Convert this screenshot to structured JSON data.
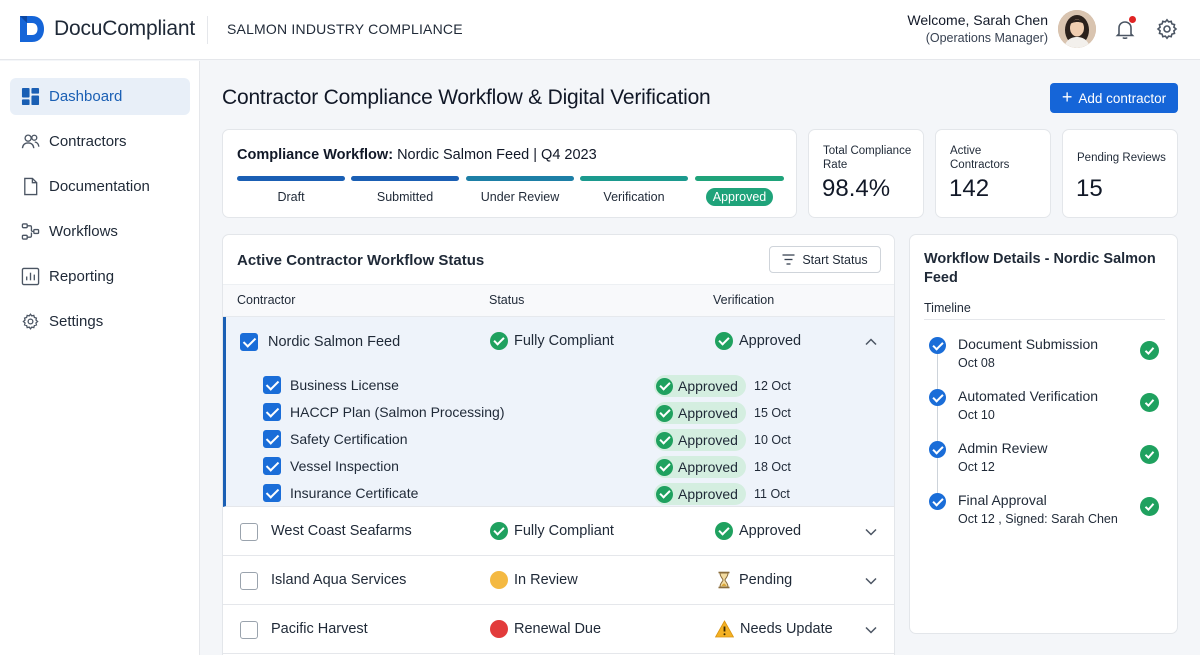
{
  "app": {
    "name": "DocuCompliant",
    "subtitle": "SALMON INDUSTRY COMPLIANCE"
  },
  "user": {
    "welcome": "Welcome, Sarah Chen",
    "role": "(Operations Manager)"
  },
  "icons": {
    "notifications": "bell-icon",
    "settings": "gear-icon",
    "add": "plus-icon",
    "filter": "filter-icon"
  },
  "colors": {
    "primary": "#1565d8",
    "success": "#1fa15f",
    "warning": "#f4b942",
    "danger": "#e23b3b",
    "accent_teal": "#1fa37a"
  },
  "sidebar": {
    "items": [
      {
        "label": "Dashboard",
        "icon": "dashboard-icon",
        "active": true
      },
      {
        "label": "Contractors",
        "icon": "users-icon",
        "active": false
      },
      {
        "label": "Documentation",
        "icon": "document-icon",
        "active": false
      },
      {
        "label": "Workflows",
        "icon": "workflow-icon",
        "active": false
      },
      {
        "label": "Reporting",
        "icon": "chart-icon",
        "active": false
      },
      {
        "label": "Settings",
        "icon": "gear-icon",
        "active": false
      }
    ]
  },
  "main": {
    "title": "Contractor Compliance Workflow & Digital Verification",
    "add_button": "Add contractor"
  },
  "workflow": {
    "title_bold": "Compliance Workflow:",
    "title_rest": "Nordic Salmon Feed | Q4 2023",
    "steps": [
      {
        "label": "Draft"
      },
      {
        "label": "Submitted"
      },
      {
        "label": "Under Review"
      },
      {
        "label": "Verification"
      },
      {
        "label": "Approved"
      }
    ]
  },
  "stats": [
    {
      "label": "Total Compliance Rate",
      "value": "98.4%"
    },
    {
      "label": "Active Contractors",
      "value": "142"
    },
    {
      "label": "Pending Reviews",
      "value": "15"
    }
  ],
  "table": {
    "title": "Active Contractor Workflow Status",
    "filter_label": "Start Status",
    "headers": {
      "contractor": "Contractor",
      "status": "Status",
      "verification": "Verification"
    },
    "rows": [
      {
        "name": "Nordic Salmon Feed",
        "status": "Fully Compliant",
        "status_icon": "check-circle-icon",
        "verification": "Approved",
        "verification_icon": "check-circle-icon",
        "checked": true,
        "expanded": true
      },
      {
        "name": "West Coast Seafarms",
        "status": "Fully Compliant",
        "status_icon": "check-circle-icon",
        "verification": "Approved",
        "verification_icon": "check-circle-icon",
        "checked": false,
        "expanded": false
      },
      {
        "name": "Island Aqua Services",
        "status": "In Review",
        "status_icon": "amber-dot-icon",
        "verification": "Pending",
        "verification_icon": "hourglass-icon",
        "checked": false,
        "expanded": false
      },
      {
        "name": "Pacific Harvest",
        "status": "Renewal Due",
        "status_icon": "red-dot-icon",
        "verification": "Needs Update",
        "verification_icon": "warning-icon",
        "checked": false,
        "expanded": false
      }
    ],
    "documents": [
      {
        "name": "Business License",
        "status": "Approved",
        "date": "12 Oct"
      },
      {
        "name": "HACCP Plan (Salmon Processing)",
        "status": "Approved",
        "date": "15 Oct"
      },
      {
        "name": "Safety Certification",
        "status": "Approved",
        "date": "10 Oct"
      },
      {
        "name": "Vessel Inspection",
        "status": "Approved",
        "date": "18 Oct"
      },
      {
        "name": "Insurance Certificate",
        "status": "Approved",
        "date": "11 Oct"
      }
    ]
  },
  "details": {
    "title": "Workflow Details - Nordic Salmon Feed",
    "subtitle": "Timeline",
    "timeline": [
      {
        "title": "Document Submission",
        "meta": "Oct 08"
      },
      {
        "title": "Automated Verification",
        "meta": "Oct 10"
      },
      {
        "title": "Admin Review",
        "meta": "Oct 12"
      },
      {
        "title": "Final Approval",
        "meta": "Oct 12 , Signed: Sarah Chen"
      }
    ]
  }
}
